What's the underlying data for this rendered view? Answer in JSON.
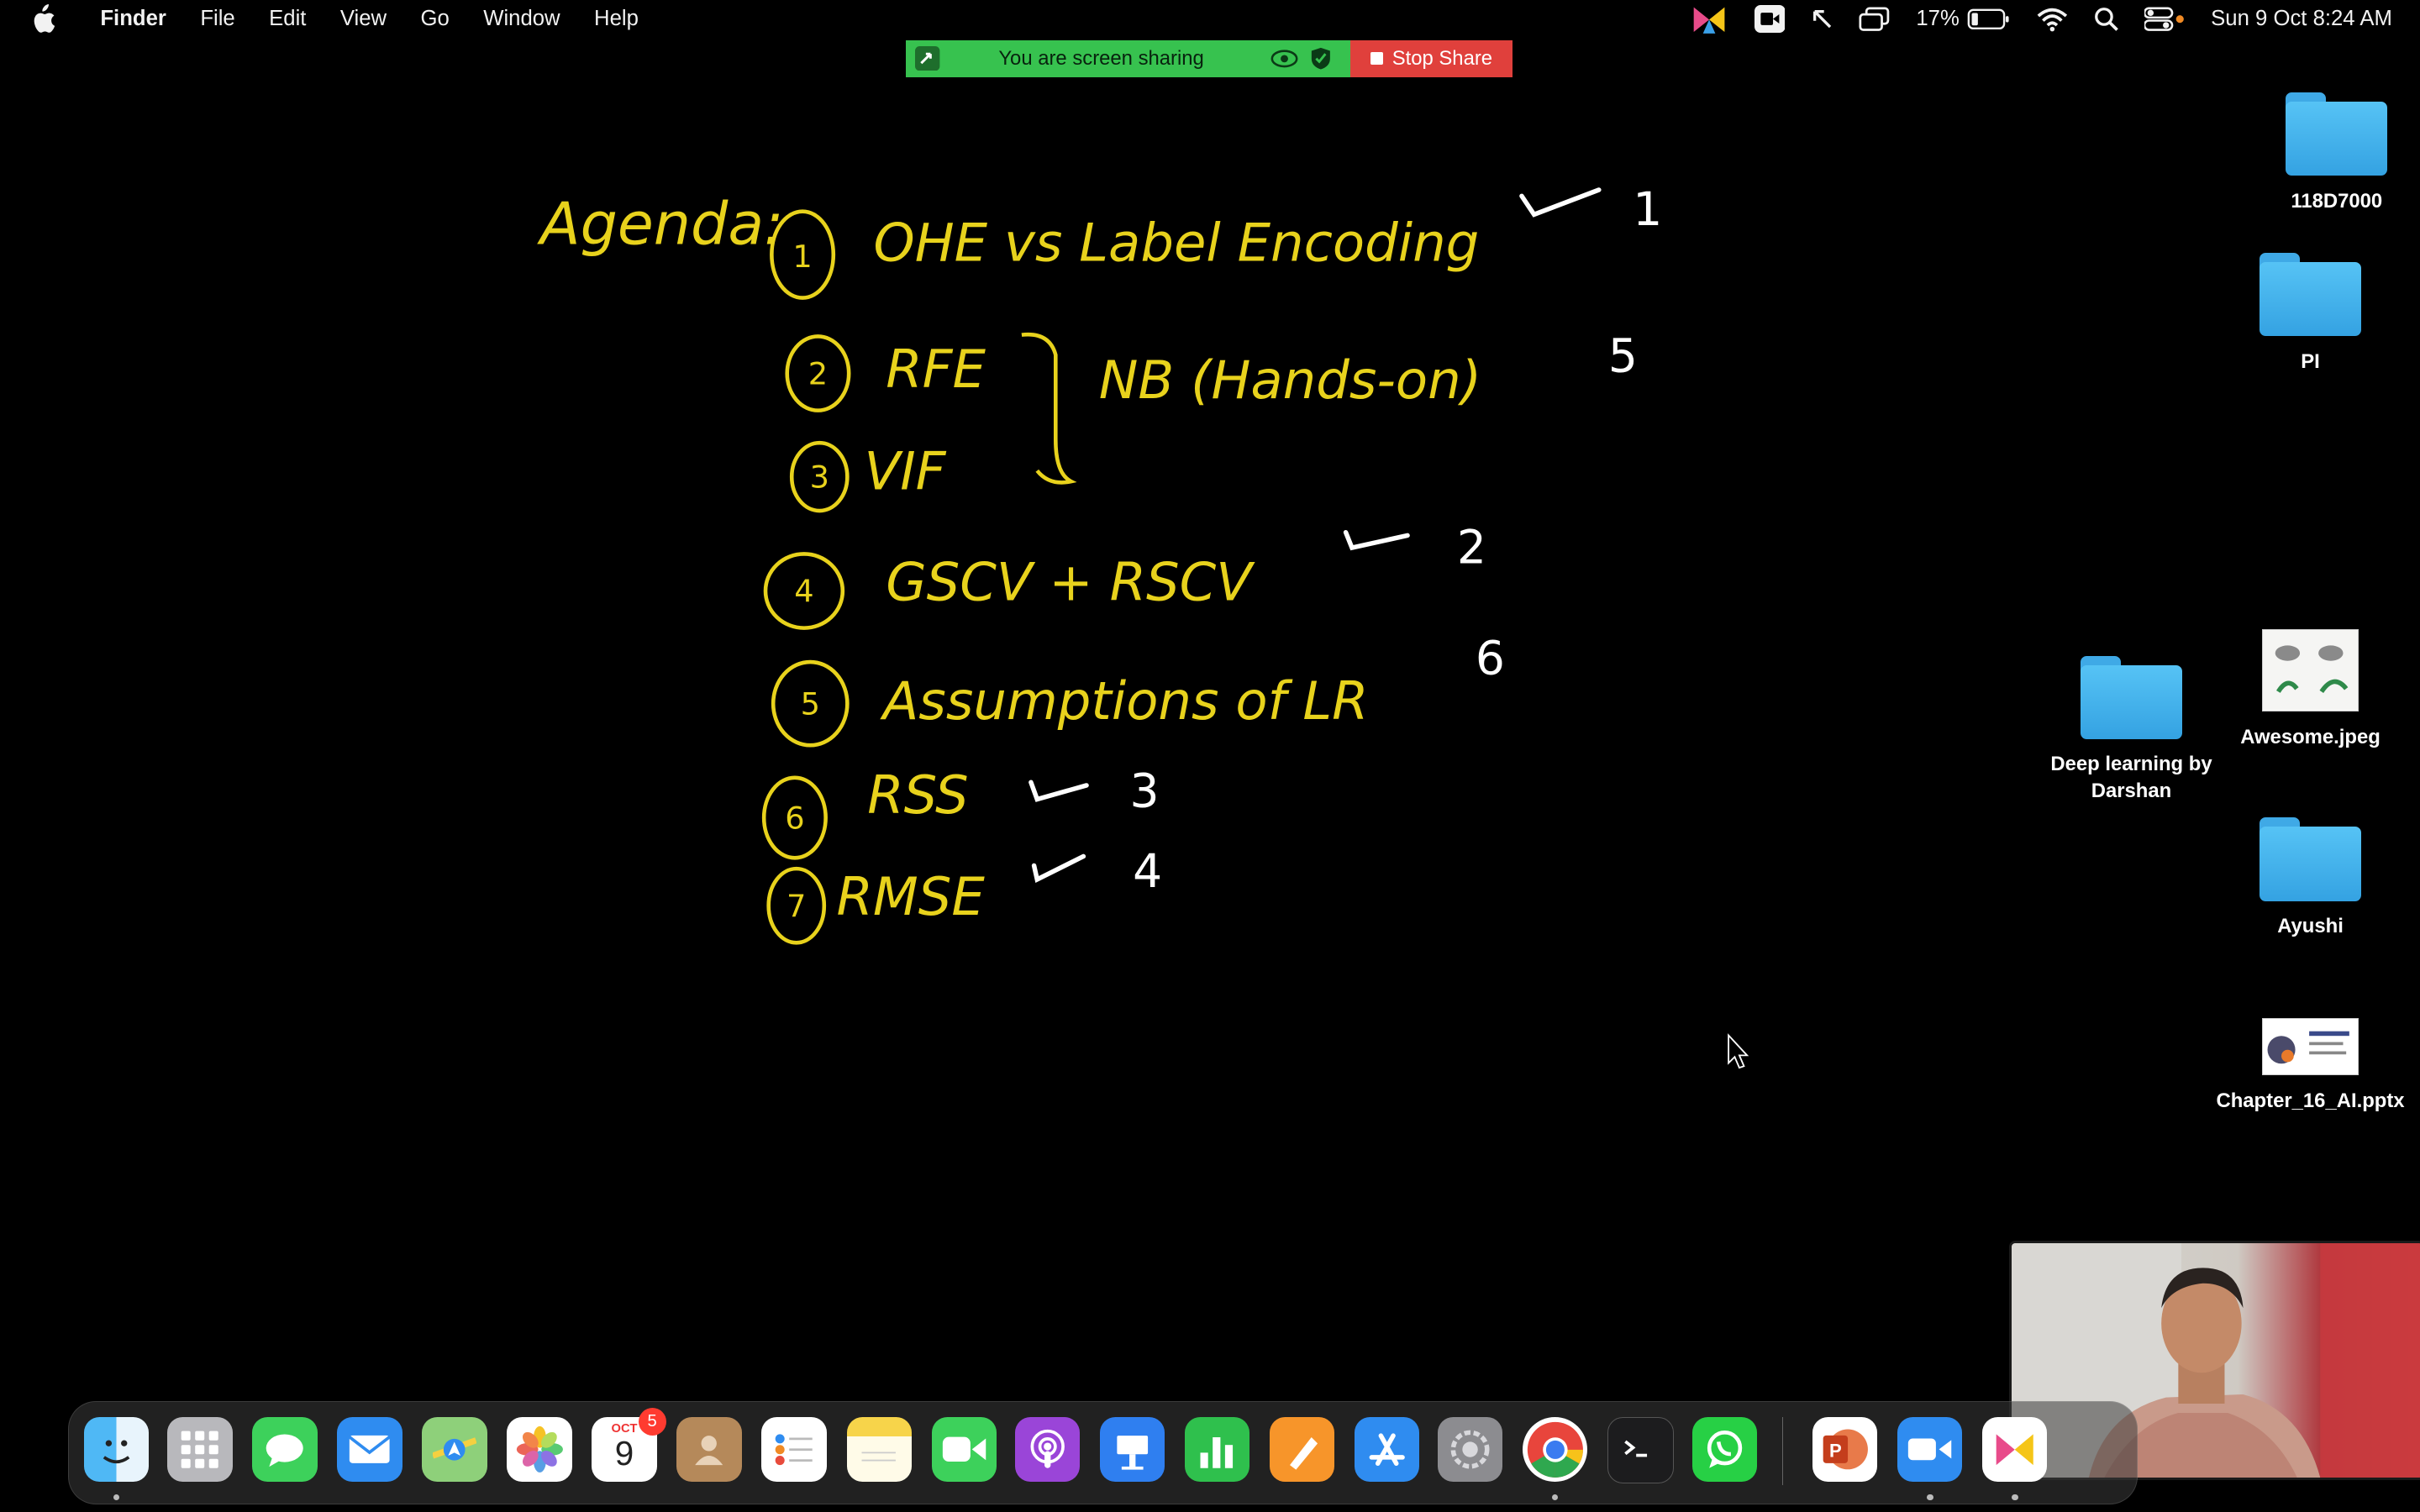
{
  "menubar": {
    "app_name": "Finder",
    "menus": [
      "File",
      "Edit",
      "View",
      "Go",
      "Window",
      "Help"
    ],
    "battery_percent": "17%",
    "clock": "Sun 9 Oct  8:24 AM"
  },
  "share_banner": {
    "status_text": "You are screen sharing",
    "stop_label": "Stop Share",
    "status_color": "#37c24f",
    "stop_color": "#e0403c"
  },
  "whiteboard": {
    "heading": "Agenda:",
    "ink_color": "#e8d21c",
    "mark_color": "#ffffff",
    "items": [
      {
        "number": "1",
        "text": "OHE vs Label Encoding",
        "order": "1",
        "checked": true
      },
      {
        "number": "2",
        "text": "RFE",
        "order": "",
        "checked": false
      },
      {
        "number": "3",
        "text": "VIF",
        "order": "",
        "checked": false
      },
      {
        "number": "4",
        "text": "GSCV + RSCV",
        "order": "2",
        "checked": true
      },
      {
        "number": "5",
        "text": "Assumptions of  LR",
        "order": "6",
        "checked": false
      },
      {
        "number": "6",
        "text": "RSS",
        "order": "3",
        "checked": true
      },
      {
        "number": "7",
        "text": "RMSE",
        "order": "4",
        "checked": true
      }
    ],
    "group_note": "NB (Hands-on)",
    "group_order": "5"
  },
  "desktop_icons": {
    "folder_118": "118D7000",
    "folder_pi": "PI",
    "folder_deep": "Deep learning by Darshan",
    "image_awesome": "Awesome.jpeg",
    "folder_ayushi": "Ayushi",
    "file_chapter": "Chapter_16_AI.pptx"
  },
  "dock": {
    "apps": [
      "finder-icon",
      "launchpad-icon",
      "messages-icon",
      "mail-icon",
      "maps-icon",
      "photos-icon",
      "calendar-icon",
      "contacts-icon",
      "reminders-icon",
      "notes-icon",
      "facetime-icon",
      "podcasts-icon",
      "keynote-icon",
      "numbers-icon",
      "pages-icon",
      "app-store-icon",
      "system-settings-icon",
      "chrome-icon",
      "terminal-icon",
      "whatsapp-icon",
      "powerpoint-icon",
      "zoom-icon",
      "kite-icon"
    ],
    "calendar_month": "OCT",
    "calendar_day": "9",
    "calendar_badge": "5"
  }
}
